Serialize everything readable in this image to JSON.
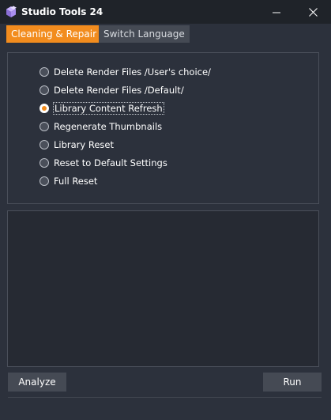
{
  "window": {
    "title": "Studio Tools 24",
    "icon": "app-cube-icon",
    "controls": [
      "minimize-icon",
      "close-icon"
    ]
  },
  "tabs": [
    {
      "label": "Cleaning & Repair",
      "active": true
    },
    {
      "label": "Switch Language",
      "active": false
    }
  ],
  "options": {
    "items": [
      {
        "label": "Delete Render Files /User's choice/",
        "checked": false
      },
      {
        "label": "Delete Render Files /Default/",
        "checked": false
      },
      {
        "label": "Library Content Refresh",
        "checked": true
      },
      {
        "label": "Regenerate Thumbnails",
        "checked": false
      },
      {
        "label": "Library Reset",
        "checked": false
      },
      {
        "label": "Reset to Default Settings",
        "checked": false
      },
      {
        "label": "Full Reset",
        "checked": false
      }
    ]
  },
  "log": {
    "content": ""
  },
  "actions": {
    "analyze_label": "Analyze",
    "run_label": "Run"
  },
  "colors": {
    "background": "#2c313c",
    "titlebar": "#1f2329",
    "accent": "#f28c1e",
    "button": "#454a54",
    "border": "#4a4f5a"
  }
}
